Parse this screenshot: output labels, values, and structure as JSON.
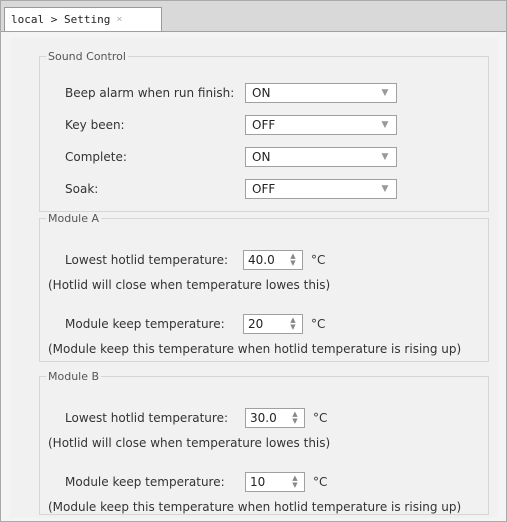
{
  "tab": {
    "label": "local > Setting",
    "close_glyph": "×"
  },
  "sound_control": {
    "legend": "Sound Control",
    "rows": [
      {
        "label": "Beep alarm when run finish:",
        "value": "ON"
      },
      {
        "label": "Key been:",
        "value": "OFF"
      },
      {
        "label": "Complete:",
        "value": "ON"
      },
      {
        "label": "Soak:",
        "value": "OFF"
      }
    ]
  },
  "module_a": {
    "legend": "Module A",
    "lowest_label": "Lowest hotlid temperature:",
    "lowest_value": "40.0",
    "lowest_unit": "°C",
    "lowest_note": "(Hotlid will close when temperature lowes this)",
    "keep_label": "Module keep temperature:",
    "keep_value": "20",
    "keep_unit": "°C",
    "keep_note": "(Module keep this temperature when hotlid temperature is rising up)"
  },
  "module_b": {
    "legend": "Module B",
    "lowest_label": "Lowest hotlid temperature:",
    "lowest_value": "30.0",
    "lowest_unit": "°C",
    "lowest_note": "(Hotlid will close when temperature lowes this)",
    "keep_label": "Module keep temperature:",
    "keep_value": "10",
    "keep_unit": "°C",
    "keep_note": "(Module keep this temperature when hotlid temperature is  rising up)"
  },
  "icons": {
    "dropdown": "chevron-down-icon",
    "spinner": "spinner-arrows-icon"
  }
}
